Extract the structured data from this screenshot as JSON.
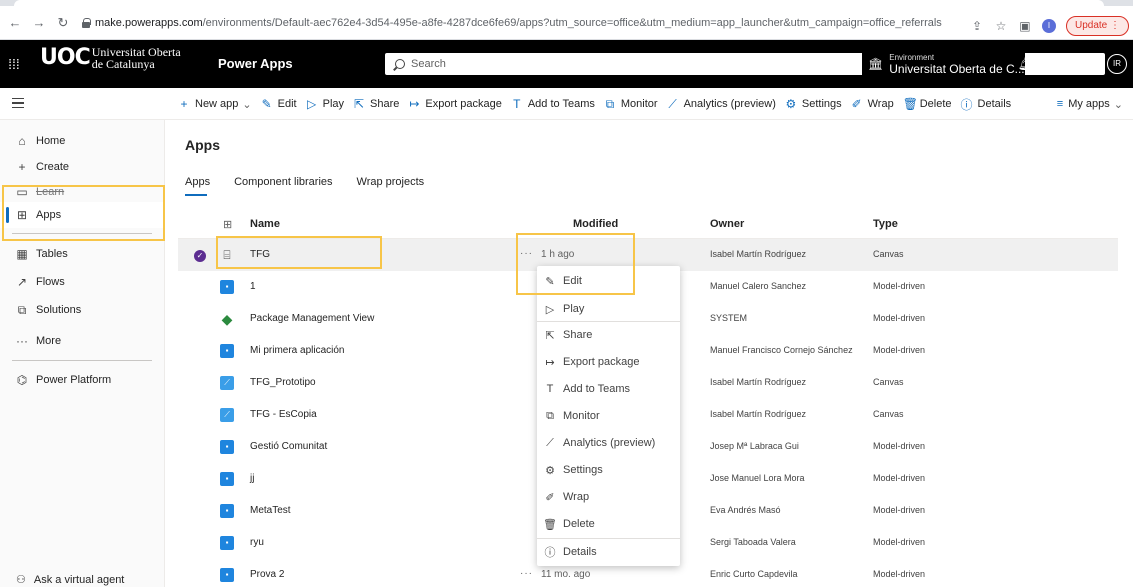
{
  "browser": {
    "url_host": "make.powerapps.com",
    "url_path": "/environments/Default-aec762e4-3d54-495e-a8fe-4287dce6fe69/apps?utm_source=office&utm_medium=app_launcher&utm_campaign=office_referrals",
    "profile_initial": "I",
    "update_label": "Update"
  },
  "header": {
    "org_logo_mark": "UOC",
    "org_line1": "Universitat Oberta",
    "org_line2": "de Catalunya",
    "app_name": "Power Apps",
    "search_placeholder": "Search",
    "env_label": "Environment",
    "env_name": "Universitat Oberta de C...",
    "avatar_initials": "IR"
  },
  "commandbar": {
    "items": [
      {
        "icon": "plus-icon",
        "label": "New app"
      },
      {
        "icon": "edit-icon",
        "label": "Edit"
      },
      {
        "icon": "play-icon",
        "label": "Play"
      },
      {
        "icon": "share-icon",
        "label": "Share"
      },
      {
        "icon": "export-icon",
        "label": "Export package"
      },
      {
        "icon": "teams-icon",
        "label": "Add to Teams"
      },
      {
        "icon": "monitor-icon",
        "label": "Monitor"
      },
      {
        "icon": "analytics-icon",
        "label": "Analytics (preview)"
      },
      {
        "icon": "settings-icon",
        "label": "Settings"
      },
      {
        "icon": "wrap-icon",
        "label": "Wrap"
      },
      {
        "icon": "delete-icon",
        "label": "Delete"
      },
      {
        "icon": "details-icon",
        "label": "Details"
      }
    ],
    "view_label": "My apps"
  },
  "leftnav": {
    "items": [
      {
        "label": "Home"
      },
      {
        "label": "Create"
      },
      {
        "label": "Learn"
      },
      {
        "label": "Apps"
      },
      {
        "label": "Tables"
      },
      {
        "label": "Flows"
      },
      {
        "label": "Solutions"
      },
      {
        "label": "More"
      },
      {
        "label": "Power Platform"
      }
    ],
    "ask_agent": "Ask a virtual agent"
  },
  "main": {
    "title": "Apps",
    "pivots": [
      "Apps",
      "Component libraries",
      "Wrap projects"
    ],
    "columns": {
      "name": "Name",
      "modified": "Modified",
      "owner": "Owner",
      "type": "Type"
    },
    "rows": [
      {
        "name": "TFG",
        "modified": "1 h ago",
        "owner": "Isabel Martín Rodríguez",
        "type": "Canvas"
      },
      {
        "name": "1",
        "modified": "",
        "owner": "Manuel Calero Sanchez",
        "type": "Model-driven"
      },
      {
        "name": "Package Management View",
        "modified": "",
        "owner": "SYSTEM",
        "type": "Model-driven"
      },
      {
        "name": "Mi primera aplicación",
        "modified": "",
        "owner": "Manuel Francisco Cornejo Sánchez",
        "type": "Model-driven"
      },
      {
        "name": "TFG_Prototipo",
        "modified": "",
        "owner": "Isabel Martín Rodríguez",
        "type": "Canvas"
      },
      {
        "name": "TFG - EsCopia",
        "modified": "",
        "owner": "Isabel Martín Rodríguez",
        "type": "Canvas"
      },
      {
        "name": "Gestió Comunitat",
        "modified": "",
        "owner": "Josep Mª Labraca Gui",
        "type": "Model-driven"
      },
      {
        "name": "jj",
        "modified": "",
        "owner": "Jose Manuel Lora Mora",
        "type": "Model-driven"
      },
      {
        "name": "MetaTest",
        "modified": "",
        "owner": "Eva Andrés Masó",
        "type": "Model-driven"
      },
      {
        "name": "ryu",
        "modified": "",
        "owner": "Sergi Taboada Valera",
        "type": "Model-driven"
      },
      {
        "name": "Prova 2",
        "modified": "11 mo. ago",
        "owner": "Enric Curto Capdevila",
        "type": "Model-driven"
      }
    ]
  },
  "context_menu": {
    "items": [
      "Edit",
      "Play",
      "Share",
      "Export package",
      "Add to Teams",
      "Monitor",
      "Analytics (preview)",
      "Settings",
      "Wrap",
      "Delete",
      "Details"
    ]
  },
  "colors": {
    "accent": "#0f6cbd",
    "highlight": "#f7c548",
    "header_bg": "#000000"
  }
}
